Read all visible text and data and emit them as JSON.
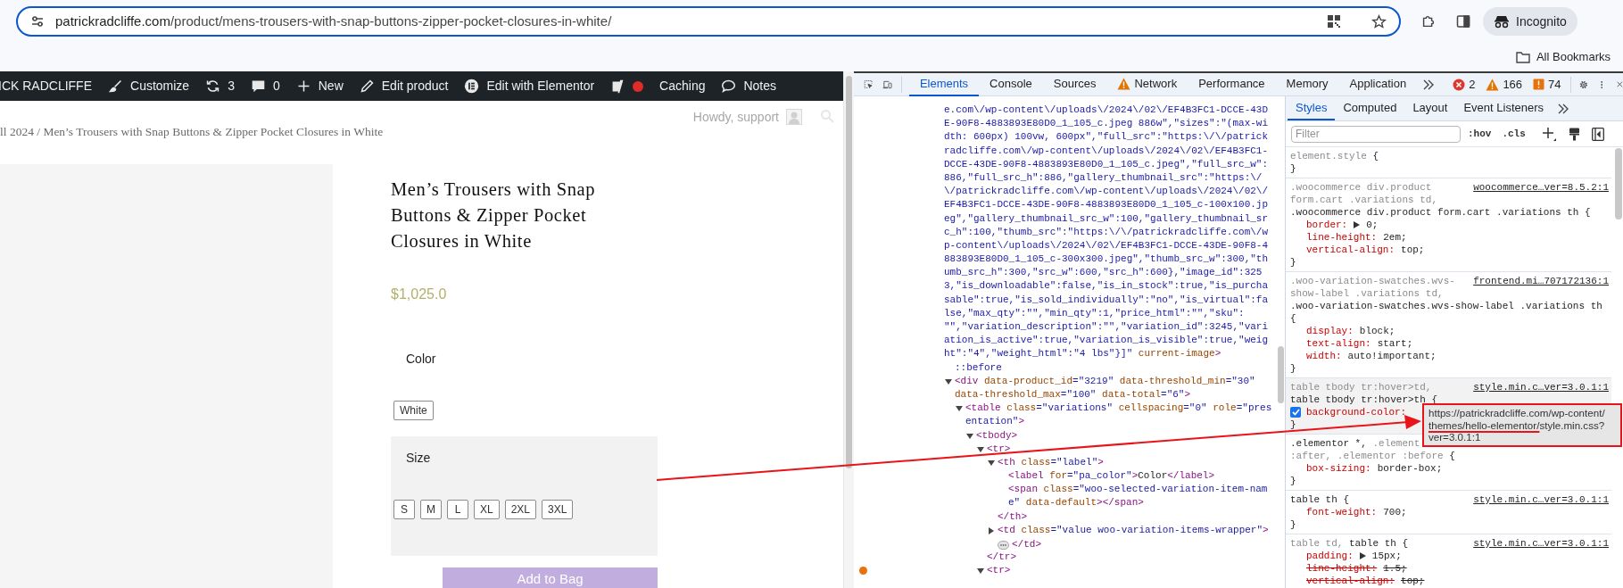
{
  "browser": {
    "url_host": "patrickradcliffe.com",
    "url_path": "/product/mens-trousers-with-snap-buttons-zipper-pocket-closures-in-white/",
    "profile": "Incognito",
    "bookmarks": "All Bookmarks"
  },
  "admin_bar": {
    "items": [
      {
        "kind": "site",
        "label": "ICK RADCLIFFE"
      },
      {
        "kind": "customize",
        "label": "Customize"
      },
      {
        "kind": "updates",
        "label": "3"
      },
      {
        "kind": "comments",
        "label": "0"
      },
      {
        "kind": "new",
        "label": "New"
      },
      {
        "kind": "edit",
        "label": "Edit product"
      },
      {
        "kind": "elementor",
        "label": "Edit with Elementor"
      },
      {
        "kind": "seo",
        "color": "#e02b27"
      },
      {
        "kind": "caching",
        "label": "Caching"
      },
      {
        "kind": "notes",
        "label": "Notes"
      }
    ],
    "greeting": "Howdy, support"
  },
  "product": {
    "breadcrumb": "ll 2024 / Men’s Trousers with Snap Buttons & Zipper Pocket Closures in White",
    "title": "Men’s Trousers with Snap Buttons & Zipper Pocket Closures in White",
    "price": "$1,025.0",
    "attributes": [
      {
        "label": "Color",
        "hovered": false,
        "options": [
          {
            "label": "White",
            "selected": false
          }
        ]
      },
      {
        "label": "Size",
        "hovered": true,
        "options": [
          {
            "label": "S",
            "selected": false
          },
          {
            "label": "M",
            "selected": false
          },
          {
            "label": "L",
            "selected": false
          },
          {
            "label": "XL",
            "selected": false
          },
          {
            "label": "2XL",
            "selected": false
          },
          {
            "label": "3XL",
            "selected": false
          }
        ]
      }
    ],
    "add_to_cart": "Add to Bag"
  },
  "devtools": {
    "tabs": [
      {
        "label": "Elements",
        "selected": true,
        "warning": false
      },
      {
        "label": "Console",
        "selected": false,
        "warning": false
      },
      {
        "label": "Sources",
        "selected": false,
        "warning": false
      },
      {
        "label": "Network",
        "selected": false,
        "warning": true
      },
      {
        "label": "Performance",
        "selected": false,
        "warning": false
      },
      {
        "label": "Memory",
        "selected": false,
        "warning": false
      },
      {
        "label": "Application",
        "selected": false,
        "warning": false
      }
    ],
    "counts": [
      {
        "kind": "error",
        "label": "2"
      },
      {
        "kind": "warning",
        "label": "166"
      },
      {
        "kind": "issue",
        "label": "74"
      }
    ],
    "dom": {
      "lines": [
        [
          {
            "kind": "value",
            "text": "e.com\\/wp-content\\/uploads\\/2024\\/02\\/EF4B3FC1-DCCE-43D"
          }
        ],
        [
          {
            "kind": "value",
            "text": "E-90F8-4883893E80D0_1_105_c.jpeg 886w\",\"sizes\":\"(max-wi"
          }
        ],
        [
          {
            "kind": "value",
            "text": "dth: 600px) 100vw, 600px\",\"full_src\":\"https:\\/\\/patrick"
          }
        ],
        [
          {
            "kind": "value",
            "text": "radcliffe.com\\/wp-content\\/uploads\\/2024\\/02\\/EF4B3FC1-"
          }
        ],
        [
          {
            "kind": "value",
            "text": "DCCE-43DE-90F8-4883893E80D0_1_105_c.jpeg\",\"full_src_w\":"
          }
        ],
        [
          {
            "kind": "value",
            "text": "886,\"full_src_h\":886,\"gallery_thumbnail_src\":\"https:\\/"
          }
        ],
        [
          {
            "kind": "value",
            "text": "\\/patrickradcliffe.com\\/wp-content\\/uploads\\/2024\\/02\\/"
          }
        ],
        [
          {
            "kind": "value",
            "text": "EF4B3FC1-DCCE-43DE-90F8-4883893E80D0_1_105_c-100x100.jp"
          }
        ],
        [
          {
            "kind": "value",
            "text": "eg\",\"gallery_thumbnail_src_w\":100,\"gallery_thumbnail_sr"
          }
        ],
        [
          {
            "kind": "value",
            "text": "c_h\":100,\"thumb_src\":\"https:\\/\\/patrickradcliffe.com\\/w"
          }
        ],
        [
          {
            "kind": "value",
            "text": "p-content\\/uploads\\/2024\\/02\\/EF4B3FC1-DCCE-43DE-90F8-4"
          }
        ],
        [
          {
            "kind": "value",
            "text": "883893E80D0_1_105_c-300x300.jpeg\",\"thumb_src_w\":300,\"th"
          }
        ],
        [
          {
            "kind": "value",
            "text": "umb_src_h\":300,\"src_w\":600,\"src_h\":600},\"image_id\":325"
          }
        ],
        [
          {
            "kind": "value",
            "text": "3,\"is_downloadable\":false,\"is_in_stock\":true,\"is_purcha"
          }
        ],
        [
          {
            "kind": "value",
            "text": "sable\":true,\"is_sold_individually\":\"no\",\"is_virtual\":fa"
          }
        ],
        [
          {
            "kind": "value",
            "text": "lse,\"max_qty\":\"\",\"min_qty\":1,\"price_html\":\"\",\"sku\":"
          }
        ],
        [
          {
            "kind": "value",
            "text": "\"\",\"variation_description\":\"\",\"variation_id\":3245,\"vari"
          }
        ],
        [
          {
            "kind": "value",
            "text": "ation_is_active\":true,\"variation_is_visible\":true,\"weig"
          }
        ],
        [
          {
            "kind": "value",
            "text": "ht\":\"4\",\"weight_html\":\"4 lbs\"}]\""
          },
          {
            "kind": "attr",
            "text": " current-image"
          },
          {
            "kind": "tag",
            "text": ">"
          }
        ]
      ],
      "children": [
        {
          "lines": [
            [
              {
                "kind": "pseudo",
                "text": "::before"
              }
            ]
          ]
        },
        {
          "expanded": true,
          "lines": [
            [
              {
                "kind": "tag",
                "text": "<div"
              },
              {
                "kind": "attr",
                "text": " data-product_id"
              },
              {
                "kind": "value",
                "text": "=\"3219\""
              },
              {
                "kind": "attr",
                "text": " data-threshold_min"
              },
              {
                "kind": "value",
                "text": "=\"30\""
              }
            ],
            [
              {
                "kind": "attr",
                "text": "data-threshold_max"
              },
              {
                "kind": "value",
                "text": "=\"100\""
              },
              {
                "kind": "attr",
                "text": " data-total"
              },
              {
                "kind": "value",
                "text": "=\"6\""
              },
              {
                "kind": "tag",
                "text": ">"
              }
            ]
          ],
          "children": [
            {
              "expanded": true,
              "lines": [
                [
                  {
                    "kind": "tag",
                    "text": "<table"
                  },
                  {
                    "kind": "attr",
                    "text": " class"
                  },
                  {
                    "kind": "value",
                    "text": "=\"variations\""
                  },
                  {
                    "kind": "attr",
                    "text": " cellspacing"
                  },
                  {
                    "kind": "value",
                    "text": "=\"0\""
                  },
                  {
                    "kind": "attr",
                    "text": " role"
                  },
                  {
                    "kind": "value",
                    "text": "=\"pres"
                  }
                ],
                [
                  {
                    "kind": "value",
                    "text": "entation\""
                  },
                  {
                    "kind": "tag",
                    "text": ">"
                  }
                ]
              ],
              "children": [
                {
                  "expanded": true,
                  "lines": [
                    [
                      {
                        "kind": "tag",
                        "text": "<tbody>"
                      }
                    ]
                  ],
                  "children": [
                    {
                      "expanded": true,
                      "lines": [
                        [
                          {
                            "kind": "tag",
                            "text": "<tr>"
                          }
                        ]
                      ],
                      "children": [
                        {
                          "expanded": true,
                          "lines": [
                            [
                              {
                                "kind": "tag",
                                "text": "<th"
                              },
                              {
                                "kind": "attr",
                                "text": " class"
                              },
                              {
                                "kind": "value",
                                "text": "=\"label\""
                              },
                              {
                                "kind": "tag",
                                "text": ">"
                              }
                            ]
                          ],
                          "children": [
                            {
                              "lines": [
                                [
                                  {
                                    "kind": "tag",
                                    "text": "<label"
                                  },
                                  {
                                    "kind": "attr",
                                    "text": " for"
                                  },
                                  {
                                    "kind": "value",
                                    "text": "=\"pa_color\""
                                  },
                                  {
                                    "kind": "tag",
                                    "text": ">"
                                  },
                                  {
                                    "kind": "text",
                                    "text": "Color"
                                  },
                                  {
                                    "kind": "tag",
                                    "text": "</label>"
                                  }
                                ]
                              ]
                            },
                            {
                              "lines": [
                                [
                                  {
                                    "kind": "tag",
                                    "text": "<span"
                                  },
                                  {
                                    "kind": "attr",
                                    "text": " class"
                                  },
                                  {
                                    "kind": "value",
                                    "text": "=\"woo-selected-variation-item-nam"
                                  }
                                ],
                                [
                                  {
                                    "kind": "value",
                                    "text": "e\""
                                  },
                                  {
                                    "kind": "attr",
                                    "text": " data-default"
                                  },
                                  {
                                    "kind": "tag",
                                    "text": "></span>"
                                  }
                                ]
                              ]
                            }
                          ],
                          "close": [
                            {
                              "kind": "tag",
                              "text": "</th>"
                            }
                          ]
                        },
                        {
                          "expanded": false,
                          "lines": [
                            [
                              {
                                "kind": "tag",
                                "text": "<td"
                              },
                              {
                                "kind": "attr",
                                "text": " class"
                              },
                              {
                                "kind": "value",
                                "text": "=\"value woo-variation-items-wrapper\""
                              },
                              {
                                "kind": "tag",
                                "text": ">"
                              }
                            ]
                          ],
                          "close": [
                            {
                              "kind": "tag",
                              "text": "</td>"
                            }
                          ]
                        }
                      ],
                      "close": [
                        {
                          "kind": "tag",
                          "text": "</tr>"
                        }
                      ]
                    },
                    {
                      "expanded": true,
                      "breakpoint": true,
                      "lines": [
                        [
                          {
                            "kind": "tag",
                            "text": "<tr>"
                          }
                        ]
                      ]
                    }
                  ]
                }
              ]
            }
          ]
        }
      ]
    },
    "styles": {
      "tabs": [
        {
          "label": "Styles",
          "selected": true
        },
        {
          "label": "Computed",
          "selected": false
        },
        {
          "label": "Layout",
          "selected": false
        },
        {
          "label": "Event Listeners",
          "selected": false
        }
      ],
      "filter_placeholder": "Filter",
      "hov": ":hov",
      "cls": ".cls",
      "rules": [
        {
          "hovered": false,
          "selector_lines": [
            [
              {
                "text": "element.style",
                "matched": false
              },
              {
                "text": " {",
                "matched": true
              }
            ]
          ],
          "close": "}"
        },
        {
          "hovered": false,
          "source": "woocommerce…ver=8.5.2:1",
          "selector_lines": [
            [
              {
                "text": ".woocommerce div.product",
                "matched": false
              }
            ],
            [
              {
                "text": "form.cart .variations td,",
                "matched": false
              }
            ],
            [
              {
                "text": ".woocommerce div.product form.cart .variations th {",
                "matched": true
              }
            ]
          ],
          "properties": [
            {
              "name": "border:",
              "value": "0;",
              "expandable": true,
              "overridden": false
            },
            {
              "name": "line-height:",
              "value": "2em;",
              "expandable": false,
              "overridden": false
            },
            {
              "name": "vertical-align:",
              "value": "top;",
              "expandable": false,
              "overridden": false
            }
          ],
          "close": "}"
        },
        {
          "hovered": false,
          "source": "frontend.mi…707172136:1",
          "selector_lines": [
            [
              {
                "text": ".woo-variation-swatches.wvs-",
                "matched": false
              }
            ],
            [
              {
                "text": "show-label .variations td,",
                "matched": false
              }
            ],
            [
              {
                "text": ".woo-variation-swatches.wvs-show-label .variations th",
                "matched": true
              }
            ],
            [
              {
                "text": "{",
                "matched": true
              }
            ]
          ],
          "properties": [
            {
              "name": "display:",
              "value": "block;",
              "expandable": false,
              "overridden": false
            },
            {
              "name": "text-align:",
              "value": "start;",
              "expandable": false,
              "overridden": false
            },
            {
              "name": "width:",
              "value": "auto!important;",
              "expandable": false,
              "overridden": false
            }
          ],
          "close": "}"
        },
        {
          "hovered": true,
          "source": "style.min.c…ver=3.0.1:1",
          "selector_lines": [
            [
              {
                "text": "table tbody tr:hover>td,",
                "matched": false
              }
            ],
            [
              {
                "text": "table tbody tr:hover>th {",
                "matched": true
              }
            ]
          ],
          "properties": [
            {
              "name": "background-color:",
              "enabled": true,
              "expandable": false,
              "overridden": false
            }
          ],
          "close": "}"
        },
        {
          "hovered": false,
          "selector_lines": [
            [
              {
                "text": ".elementor *,",
                "matched": true
              },
              {
                "text": " .element",
                "matched": false
              }
            ],
            [
              {
                "text": ":after, .elementor :before",
                "matched": false
              },
              {
                "text": " {",
                "matched": true
              }
            ]
          ],
          "properties": [
            {
              "name": "box-sizing:",
              "value": "border-box;",
              "expandable": false,
              "overridden": false
            }
          ],
          "close": "}"
        },
        {
          "hovered": false,
          "source": "style.min.c…ver=3.0.1:1",
          "selector_lines": [
            [
              {
                "text": "table th {",
                "matched": true
              }
            ]
          ],
          "properties": [
            {
              "name": "font-weight:",
              "value": "700;",
              "expandable": false,
              "overridden": false
            }
          ],
          "close": "}"
        },
        {
          "hovered": false,
          "source": "style.min.c…ver=3.0.1:1",
          "selector_lines": [
            [
              {
                "text": "table td,",
                "matched": false
              },
              {
                "text": " table th {",
                "matched": true
              }
            ]
          ],
          "properties": [
            {
              "name": "padding:",
              "value": "15px;",
              "expandable": true,
              "overridden": false
            },
            {
              "name": "line-height:",
              "value": "1.5;",
              "expandable": false,
              "overridden": true
            },
            {
              "name": "vertical-align:",
              "value": "top;",
              "expandable": false,
              "overridden": true
            }
          ]
        }
      ]
    },
    "tooltip": {
      "lines": [
        [
          {
            "text": "https://patrickradcliffe.com/wp-content/",
            "underlined": false
          }
        ],
        [
          {
            "text": "themes/hello-elementor/",
            "underlined": true
          },
          {
            "text": "style.min.css?",
            "underlined": false
          }
        ],
        [
          {
            "text": "ver=3.0.1:1",
            "underlined": false
          }
        ]
      ]
    }
  }
}
